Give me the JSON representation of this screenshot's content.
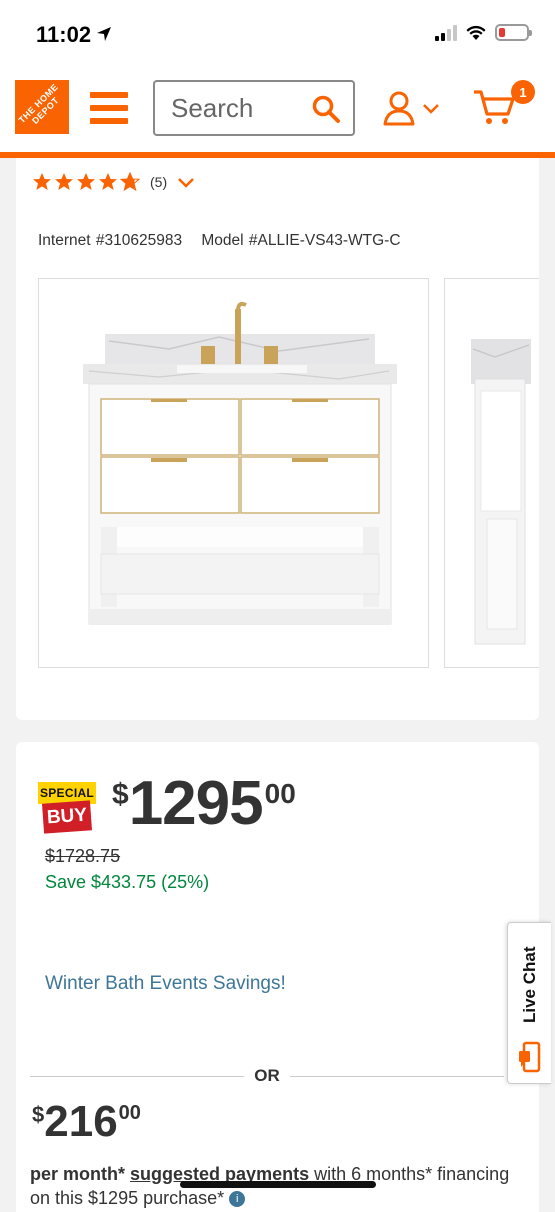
{
  "status_bar": {
    "time": "11:02"
  },
  "header": {
    "logo_text": "THE HOME DEPOT",
    "search_placeholder": "Search",
    "cart_count": "1"
  },
  "product": {
    "rating_count": "(5)",
    "internet_id": "Internet #310625983",
    "model_id": "Model #ALLIE-VS43-WTG-C"
  },
  "pricing": {
    "badge_top": "SPECIAL",
    "badge_bottom": "BUY",
    "currency": "$",
    "price_dollars": "1295",
    "price_cents": "00",
    "was_price": "$1728.75",
    "savings": "Save $433.75 (25%)",
    "promo_link": "Winter Bath Events Savings!",
    "or_label": "OR",
    "monthly_dollars": "216",
    "monthly_cents": "00",
    "per_month_bold": "per month*",
    "per_month_link": "suggested payments",
    "per_month_rest": " with 6 months* financing on this $1295 purchase*"
  },
  "live_chat": {
    "label": "Live Chat"
  },
  "colors": {
    "brand_orange": "#f96302",
    "save_green": "#00873c",
    "link_blue": "#3e7697"
  }
}
